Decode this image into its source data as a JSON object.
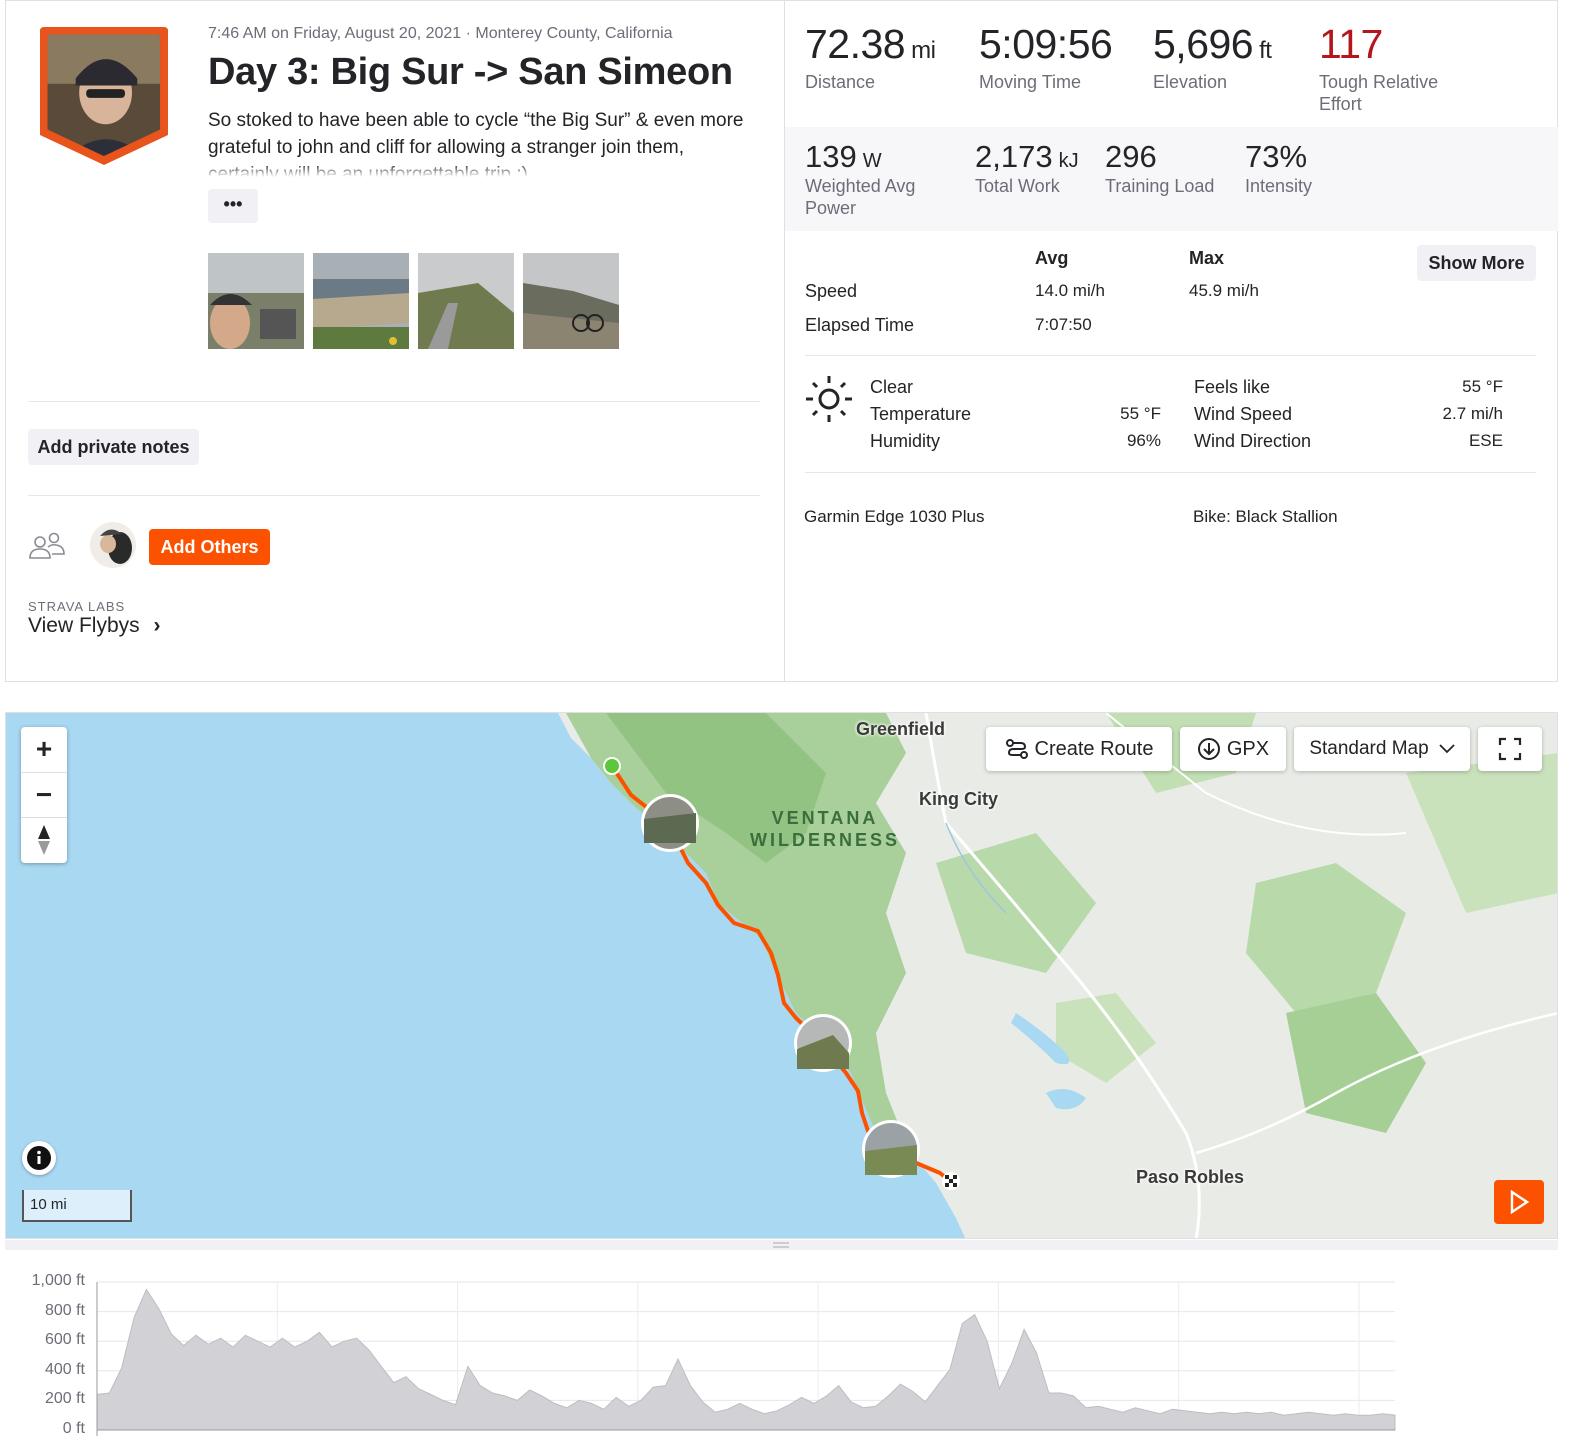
{
  "activity": {
    "meta": "7:46 AM on Friday, August 20, 2021 · Monterey County, California",
    "title": "Day 3: Big Sur -> San Simeon",
    "description": "So stoked to have been able to cycle “the Big Sur” & even more grateful to john and cliff for allowing a stranger join them, certainly will be an unforgettable trip :)",
    "more_label": "•••",
    "add_notes_label": "Add private notes",
    "add_others_label": "Add Others",
    "labs_label": "STRAVA LABS",
    "flybys_label": "View Flybys",
    "flybys_chevron": "›"
  },
  "stats": {
    "distance": {
      "value": "72.38",
      "unit": "mi",
      "label": "Distance"
    },
    "moving_time": {
      "value": "5:09:56",
      "label": "Moving Time"
    },
    "elevation": {
      "value": "5,696",
      "unit": "ft",
      "label": "Elevation"
    },
    "effort": {
      "value": "117",
      "label": "Tough Relative Effort",
      "color": "#b3161c"
    },
    "power": {
      "value": "139",
      "unit": "W",
      "label": "Weighted Avg Power"
    },
    "work": {
      "value": "2,173",
      "unit": "kJ",
      "label": "Total Work"
    },
    "training_load": {
      "value": "296",
      "label": "Training Load"
    },
    "intensity": {
      "value": "73%",
      "label": "Intensity"
    }
  },
  "table": {
    "col_avg": "Avg",
    "col_max": "Max",
    "show_more": "Show More",
    "rows": [
      {
        "label": "Speed",
        "avg": "14.0 mi/h",
        "max": "45.9 mi/h"
      },
      {
        "label": "Elapsed Time",
        "avg": "7:07:50",
        "max": ""
      }
    ]
  },
  "weather": {
    "icon": "sun-icon",
    "condition": "Clear",
    "temperature_label": "Temperature",
    "temperature": "55 °F",
    "humidity_label": "Humidity",
    "humidity": "96%",
    "feels_label": "Feels like",
    "feels": "55 °F",
    "wind_speed_label": "Wind Speed",
    "wind_speed": "2.7 mi/h",
    "wind_dir_label": "Wind Direction",
    "wind_dir": "ESE"
  },
  "gear": {
    "device": "Garmin Edge 1030 Plus",
    "bike": "Bike: Black Stallion"
  },
  "map": {
    "create_route": "Create Route",
    "gpx": "GPX",
    "map_type": "Standard Map",
    "scale": "10 mi",
    "places": {
      "greenfield": "Greenfield",
      "king_city": "King City",
      "wilderness_1": "VENTANA",
      "wilderness_2": "WILDERNESS",
      "paso_robles": "Paso Robles"
    },
    "route_color": "#fc5200",
    "start_color": "#5cc839"
  },
  "elevation_chart": {
    "type": "area",
    "ylim": [
      0,
      1000
    ],
    "yticks": [
      "1,000 ft",
      "800 ft",
      "600 ft",
      "400 ft",
      "200 ft",
      "0 ft"
    ],
    "values": [
      240,
      250,
      420,
      760,
      950,
      820,
      650,
      570,
      640,
      580,
      620,
      560,
      640,
      600,
      560,
      620,
      560,
      600,
      660,
      560,
      600,
      620,
      540,
      430,
      320,
      360,
      280,
      240,
      200,
      170,
      430,
      300,
      250,
      230,
      200,
      270,
      230,
      180,
      150,
      200,
      180,
      140,
      220,
      160,
      200,
      290,
      300,
      480,
      300,
      190,
      120,
      140,
      180,
      140,
      110,
      130,
      170,
      220,
      180,
      230,
      300,
      190,
      150,
      160,
      230,
      310,
      260,
      190,
      300,
      410,
      720,
      780,
      600,
      280,
      450,
      680,
      520,
      250,
      250,
      230,
      150,
      160,
      140,
      120,
      150,
      130,
      110,
      140,
      130,
      120,
      110,
      120,
      110,
      120,
      110,
      120,
      100,
      110,
      120,
      110,
      100,
      110,
      100,
      100,
      110,
      100
    ]
  }
}
